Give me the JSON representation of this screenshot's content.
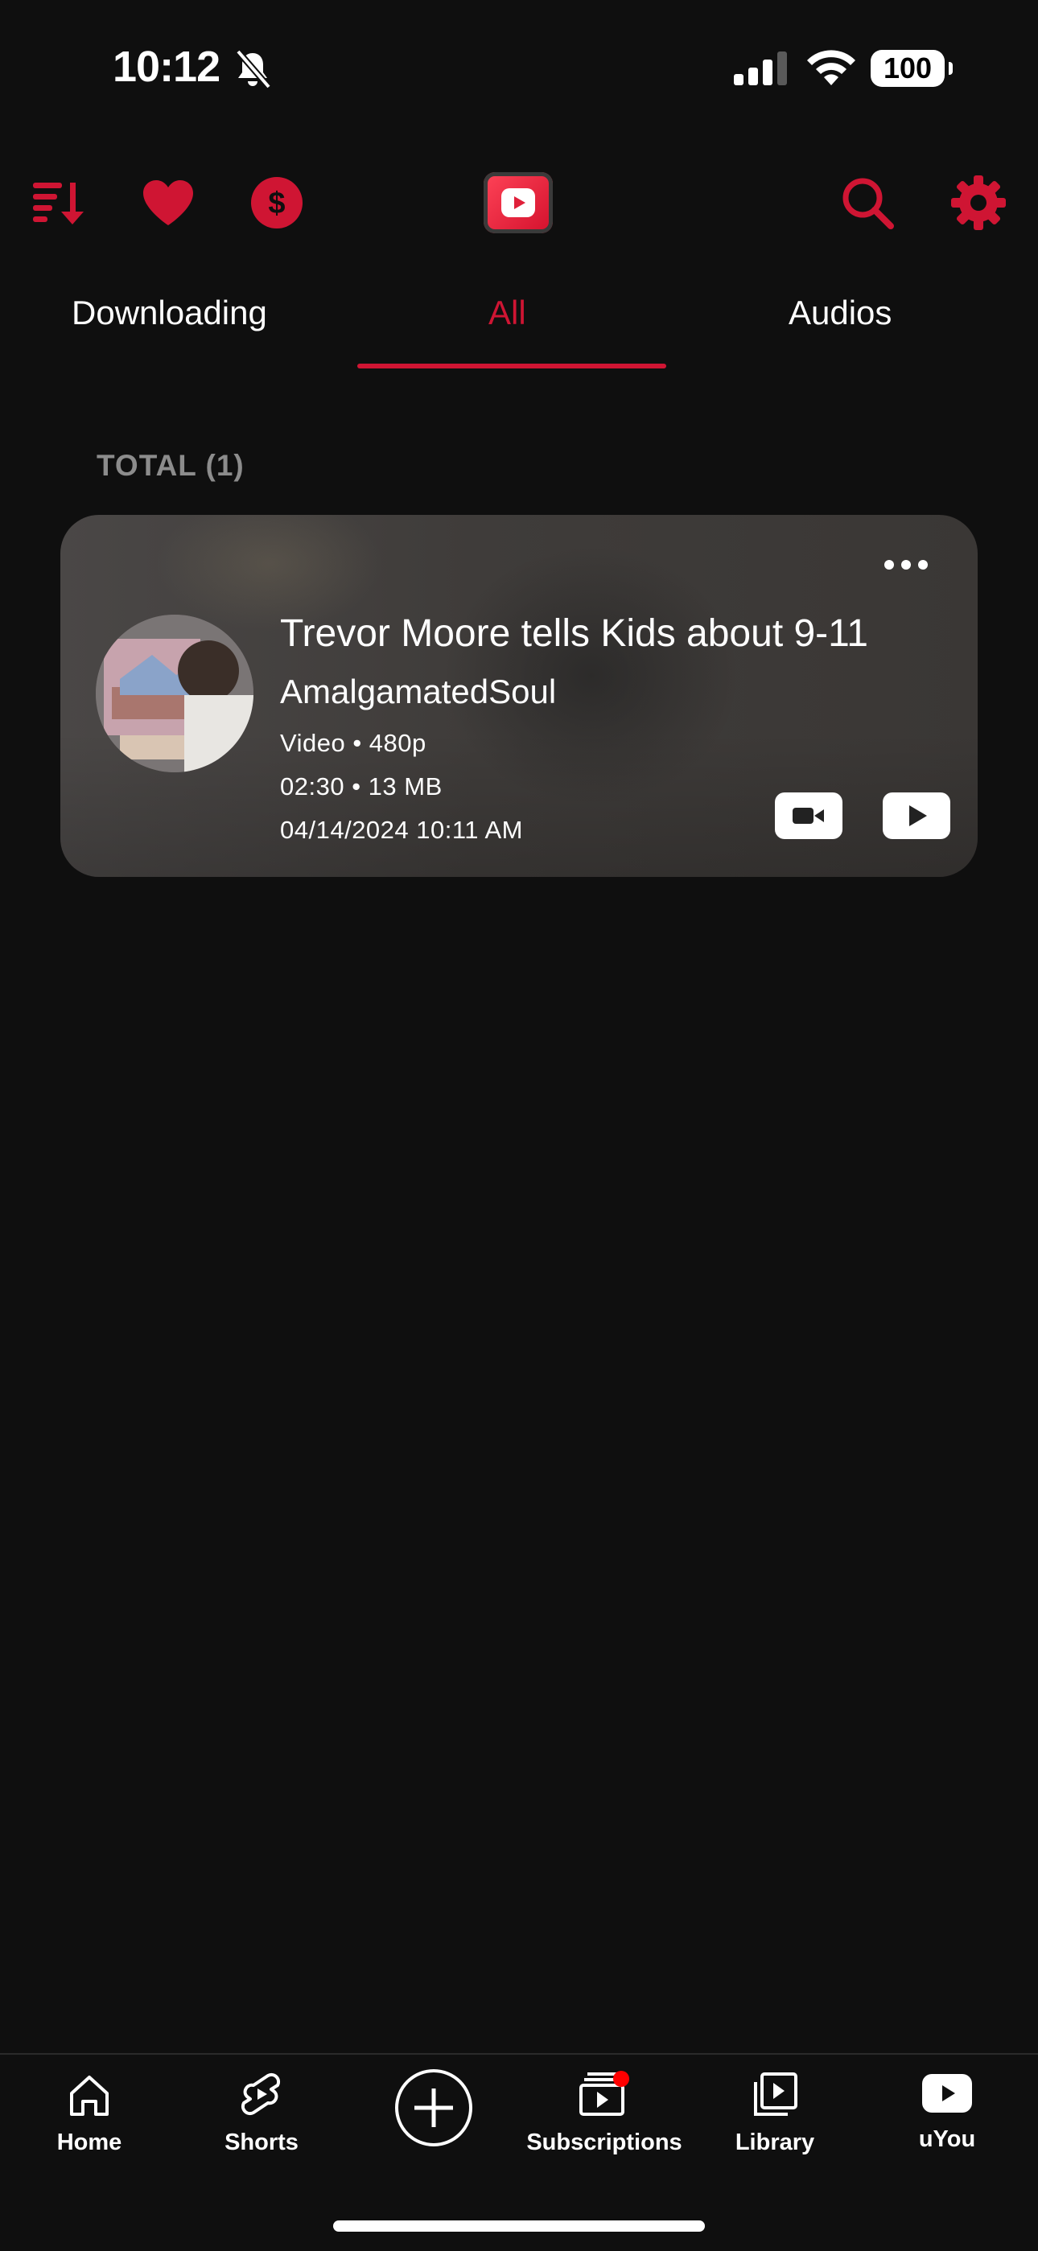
{
  "status": {
    "time": "10:12",
    "battery": "100"
  },
  "toolbar": {
    "icons": [
      "sort-icon",
      "heart-icon",
      "dollar-icon",
      "app-logo",
      "search-icon",
      "settings-icon"
    ]
  },
  "tabs": [
    {
      "label": "Downloading",
      "active": false
    },
    {
      "label": "All",
      "active": true
    },
    {
      "label": "Audios",
      "active": false
    }
  ],
  "list": {
    "total_label": "TOTAL (1)",
    "items": [
      {
        "title": "Trevor Moore tells Kids about 9-11",
        "channel": "AmalgamatedSoul",
        "type_quality": "Video • 480p",
        "duration_size": "02:30 • 13 MB",
        "date": "04/14/2024 10:11 AM"
      }
    ]
  },
  "bottom_nav": [
    {
      "label": "Home",
      "icon": "home-icon"
    },
    {
      "label": "Shorts",
      "icon": "shorts-icon"
    },
    {
      "label": "",
      "icon": "create-plus-icon"
    },
    {
      "label": "Subscriptions",
      "icon": "subscriptions-icon"
    },
    {
      "label": "Library",
      "icon": "library-icon"
    },
    {
      "label": "uYou",
      "icon": "uyou-icon"
    }
  ],
  "colors": {
    "accent": "#cf1533",
    "background": "#0f0f0f",
    "card": "#444140"
  }
}
